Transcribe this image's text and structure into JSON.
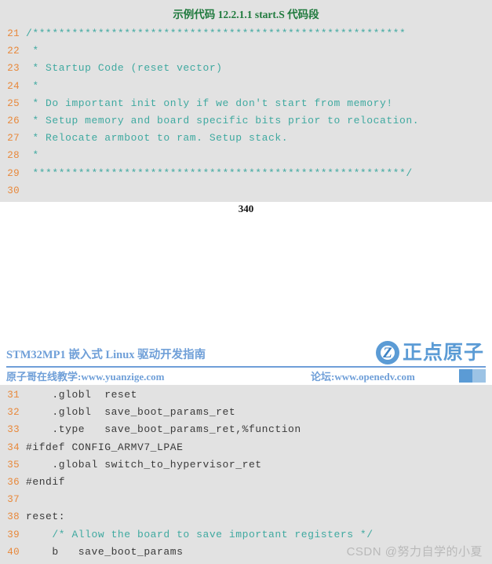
{
  "page_one": {
    "partial_top_line": "",
    "caption": "示例代码 12.2.1.1 start.S 代码段",
    "page_number": "340",
    "code_lines": [
      {
        "num": "21",
        "text": "/*********************************************************",
        "kind": "comment"
      },
      {
        "num": "22",
        "text": " *",
        "kind": "comment"
      },
      {
        "num": "23",
        "text": " * Startup Code (reset vector)",
        "kind": "comment"
      },
      {
        "num": "24",
        "text": " *",
        "kind": "comment"
      },
      {
        "num": "25",
        "text": " * Do important init only if we don't start from memory!",
        "kind": "comment"
      },
      {
        "num": "26",
        "text": " * Setup memory and board specific bits prior to relocation.",
        "kind": "comment"
      },
      {
        "num": "27",
        "text": " * Relocate armboot to ram. Setup stack.",
        "kind": "comment"
      },
      {
        "num": "28",
        "text": " *",
        "kind": "comment"
      },
      {
        "num": "29",
        "text": " *********************************************************/",
        "kind": "comment"
      },
      {
        "num": "30",
        "text": "",
        "kind": "plain"
      }
    ]
  },
  "header": {
    "title": "STM32MP1 嵌入式 Linux 驱动开发指南",
    "brand_name": "正点原子",
    "brand_mark_letter": "Z",
    "sub_left": "原子哥在线教学:www.yuanzige.com",
    "sub_right": "论坛:www.openedv.com",
    "accent_color": "#5b9bd5",
    "accent_color_light": "#9cc3e5",
    "title_color": "#6f9fd8"
  },
  "page_two": {
    "code_lines": [
      {
        "num": "31",
        "text": "    .globl  reset",
        "kind": "plain"
      },
      {
        "num": "32",
        "text": "    .globl  save_boot_params_ret",
        "kind": "plain"
      },
      {
        "num": "33",
        "text": "    .type   save_boot_params_ret,%function",
        "kind": "plain"
      },
      {
        "num": "34",
        "text": "#ifdef CONFIG_ARMV7_LPAE",
        "kind": "plain"
      },
      {
        "num": "35",
        "text": "    .global switch_to_hypervisor_ret",
        "kind": "plain"
      },
      {
        "num": "36",
        "text": "#endif",
        "kind": "plain"
      },
      {
        "num": "37",
        "text": "",
        "kind": "plain"
      },
      {
        "num": "38",
        "text": "reset:",
        "kind": "plain"
      },
      {
        "num": "39",
        "text": "    /* Allow the board to save important registers */",
        "kind": "comment"
      },
      {
        "num": "40",
        "text": "    b   save_boot_params",
        "kind": "plain"
      }
    ]
  },
  "watermark": {
    "text": "CSDN @努力自学的小夏"
  },
  "theme": {
    "code_background": "#e2e2e2",
    "line_number_color": "#e8883a",
    "comment_color": "#3fa9a0",
    "code_color": "#3a3a3a",
    "caption_color": "#1f7a3d",
    "watermark_color": "#b9b9b9"
  }
}
